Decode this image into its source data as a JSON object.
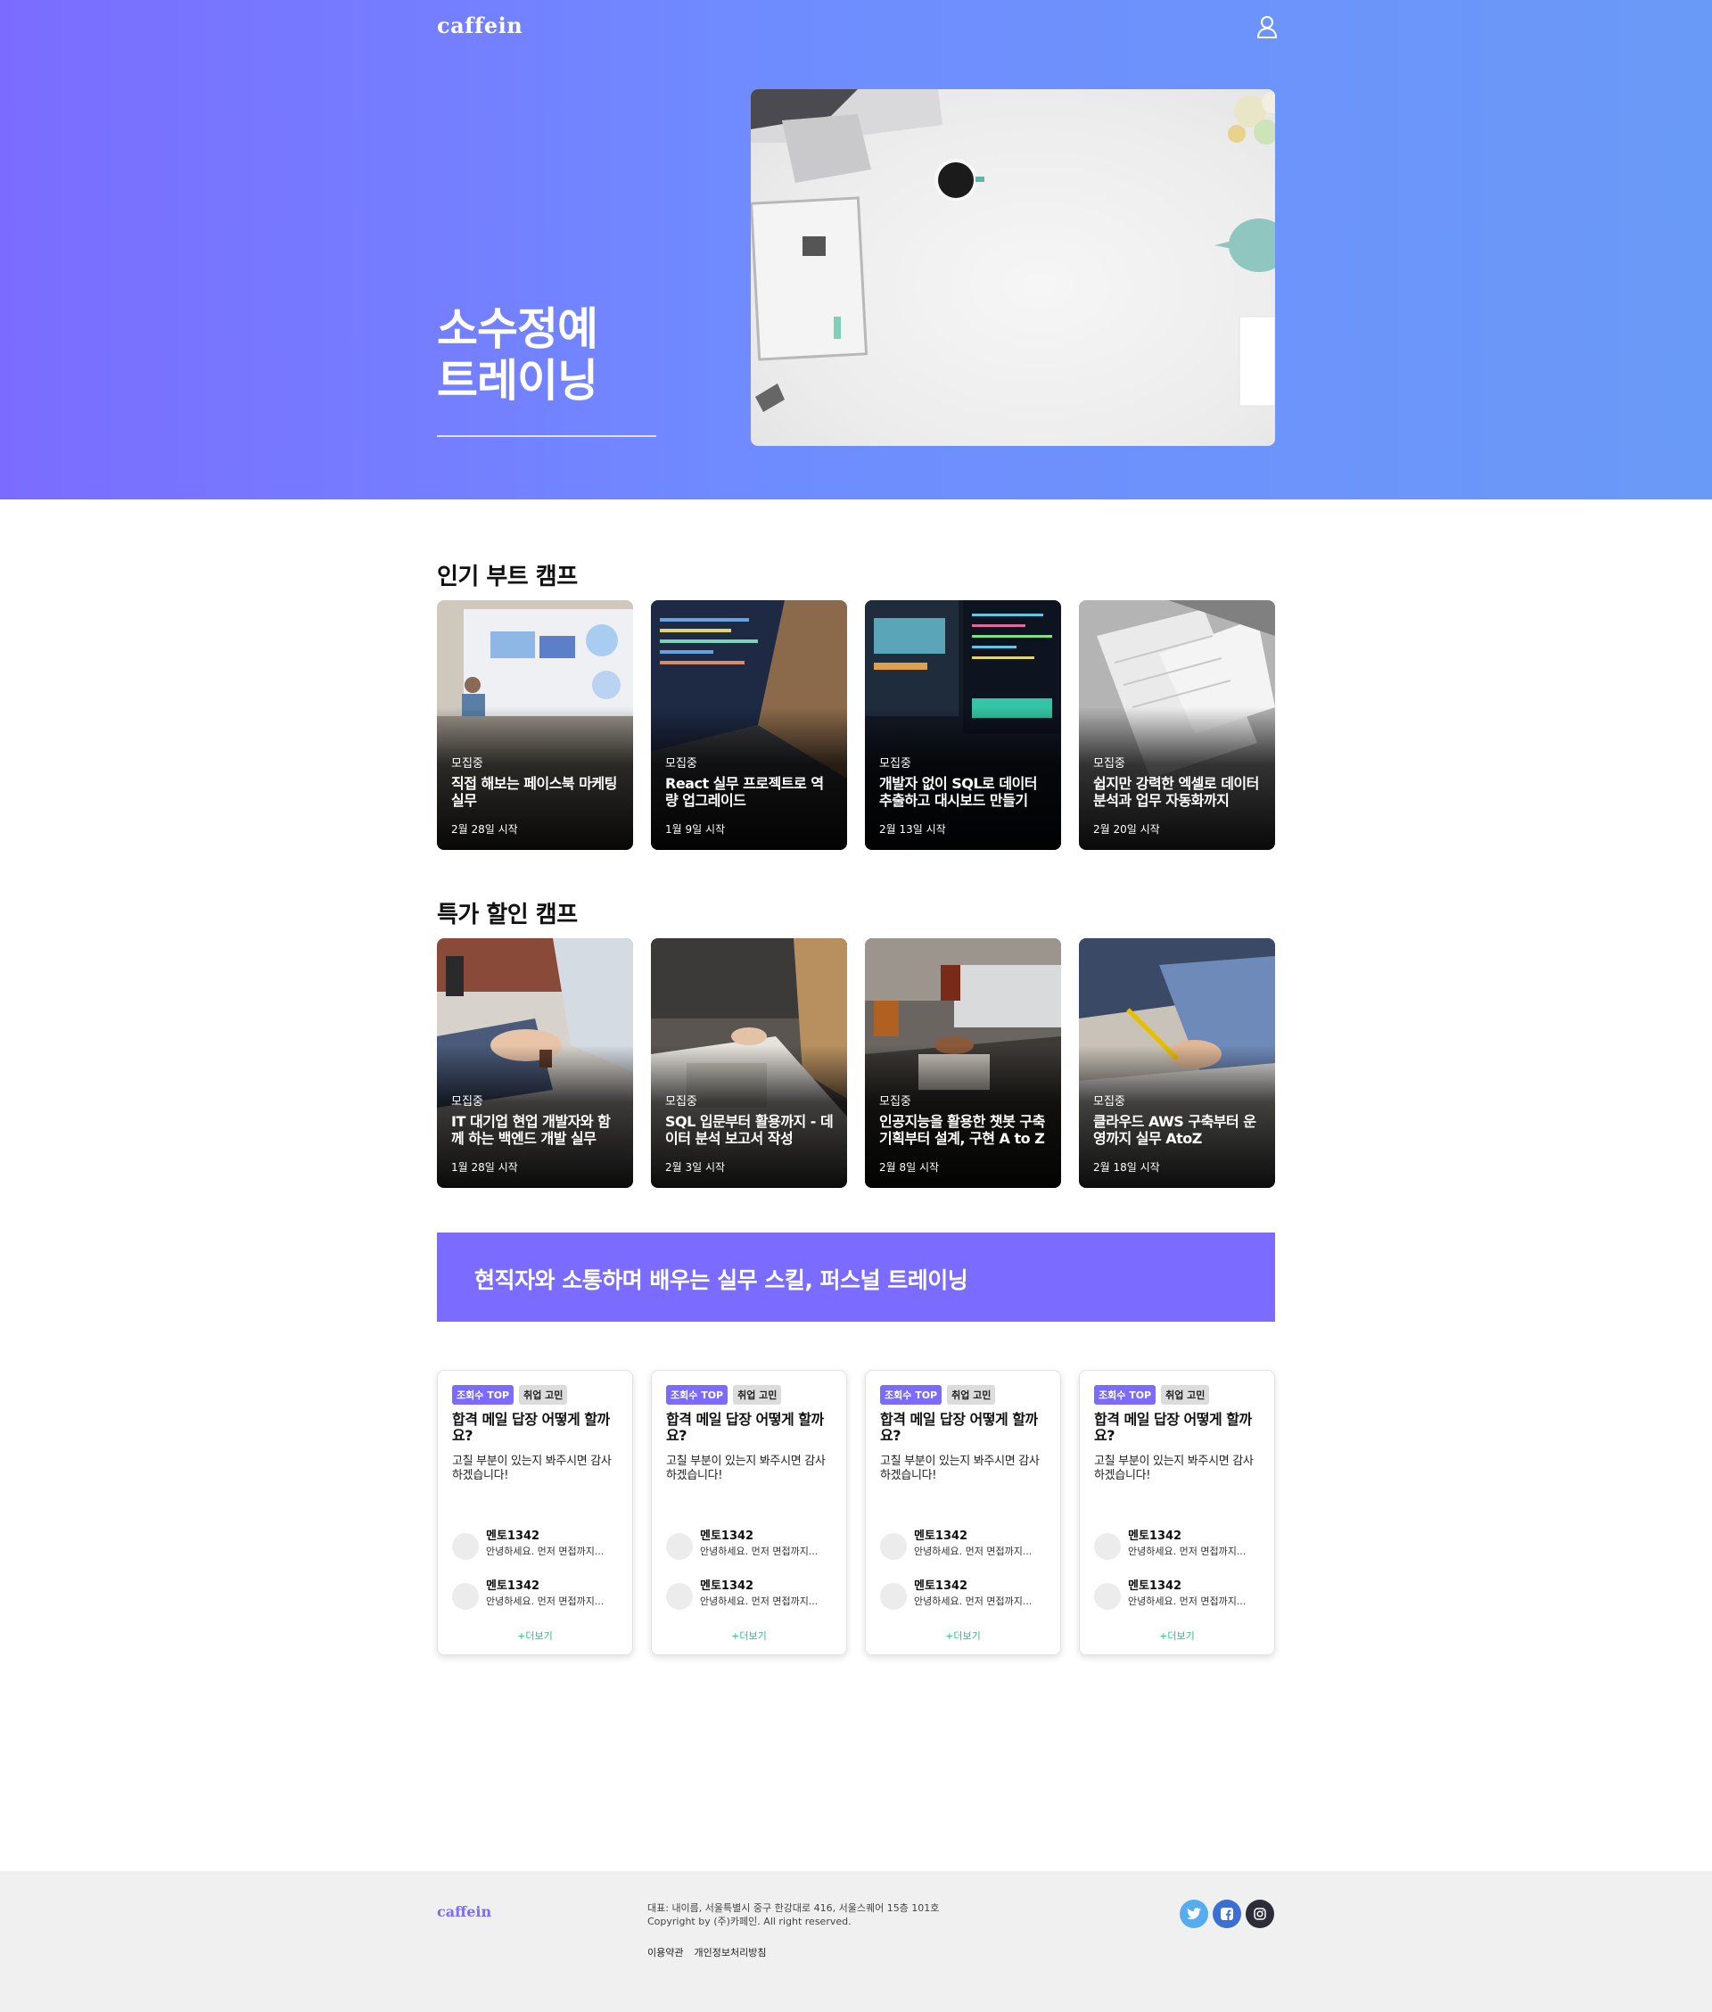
{
  "header": {
    "logo": "caffein",
    "user_icon": "user-icon"
  },
  "hero": {
    "title_line1": "소수정예",
    "title_line2": "트레이닝"
  },
  "popular": {
    "title": "인기 부트 캠프",
    "cards": [
      {
        "status": "모집중",
        "title": "직접 해보는 페이스북 마케팅 실무",
        "date": "2월 28일 시작"
      },
      {
        "status": "모집중",
        "title": "React 실무 프로젝트로 역량 업그레이드",
        "date": "1월 9일 시작"
      },
      {
        "status": "모집중",
        "title": "개발자 없이 SQL로 데이터 추출하고 대시보드 만들기",
        "date": "2월 13일 시작"
      },
      {
        "status": "모집중",
        "title": "쉽지만 강력한 엑셀로 데이터 분석과 업무 자동화까지",
        "date": "2월 20일 시작"
      }
    ]
  },
  "discount": {
    "title": "특가 할인 캠프",
    "cards": [
      {
        "status": "모집중",
        "title": "IT 대기업 현업 개발자와 함께 하는 백엔드 개발 실무",
        "date": "1월 28일 시작"
      },
      {
        "status": "모집중",
        "title": "SQL 입문부터 활용까지 - 데이터 분석 보고서 작성",
        "date": "2월 3일 시작"
      },
      {
        "status": "모집중",
        "title": "인공지능을 활용한 챗봇 구축 기획부터 설계, 구현 A to Z",
        "date": "2월 8일 시작"
      },
      {
        "status": "모집중",
        "title": "클라우드 AWS 구축부터 운영까지 실무 AtoZ",
        "date": "2월 18일 시작"
      }
    ]
  },
  "banner": {
    "text": "현직자와 소통하며 배우는 실무 스킬, 퍼스널 트레이닝"
  },
  "qa": {
    "cards": [
      {
        "badge_top": "조회수 TOP",
        "badge_job": "취업 고민",
        "title": "합격 메일 답장 어떻게 할까요?",
        "desc": "고칠 부분이 있는지 봐주시면 감사하겠습니다!",
        "mentors": [
          {
            "name": "멘토1342",
            "msg": "안녕하세요. 먼저 면접까지..."
          },
          {
            "name": "멘토1342",
            "msg": "안녕하세요. 먼저 면접까지..."
          }
        ],
        "more": "+더보기"
      },
      {
        "badge_top": "조회수 TOP",
        "badge_job": "취업 고민",
        "title": "합격 메일 답장 어떻게 할까요?",
        "desc": "고칠 부분이 있는지 봐주시면 감사하겠습니다!",
        "mentors": [
          {
            "name": "멘토1342",
            "msg": "안녕하세요. 먼저 면접까지..."
          },
          {
            "name": "멘토1342",
            "msg": "안녕하세요. 먼저 면접까지..."
          }
        ],
        "more": "+더보기"
      },
      {
        "badge_top": "조회수 TOP",
        "badge_job": "취업 고민",
        "title": "합격 메일 답장 어떻게 할까요?",
        "desc": "고칠 부분이 있는지 봐주시면 감사하겠습니다!",
        "mentors": [
          {
            "name": "멘토1342",
            "msg": "안녕하세요. 먼저 면접까지..."
          },
          {
            "name": "멘토1342",
            "msg": "안녕하세요. 먼저 면접까지..."
          }
        ],
        "more": "+더보기"
      },
      {
        "badge_top": "조회수 TOP",
        "badge_job": "취업 고민",
        "title": "합격 메일 답장 어떻게 할까요?",
        "desc": "고칠 부분이 있는지 봐주시면 감사하겠습니다!",
        "mentors": [
          {
            "name": "멘토1342",
            "msg": "안녕하세요. 먼저 면접까지..."
          },
          {
            "name": "멘토1342",
            "msg": "안녕하세요. 먼저 면접까지..."
          }
        ],
        "more": "+더보기"
      }
    ]
  },
  "footer": {
    "logo": "caffein",
    "address": "대표: 내이름, 서울특별시 중구 한강대로 416, 서울스퀘어 15층 101호",
    "copyright": "Copyright by (주)카페인. All right reserved.",
    "links": [
      "이용약관",
      "개인정보처리방침"
    ],
    "social": [
      "twitter-icon",
      "facebook-icon",
      "instagram-icon"
    ]
  },
  "colors": {
    "brand": "#7b6cff",
    "more_link": "#2ebf7f",
    "twitter": "#55acee",
    "facebook": "#3b6fd1",
    "instagram": "#2d2d3a"
  }
}
